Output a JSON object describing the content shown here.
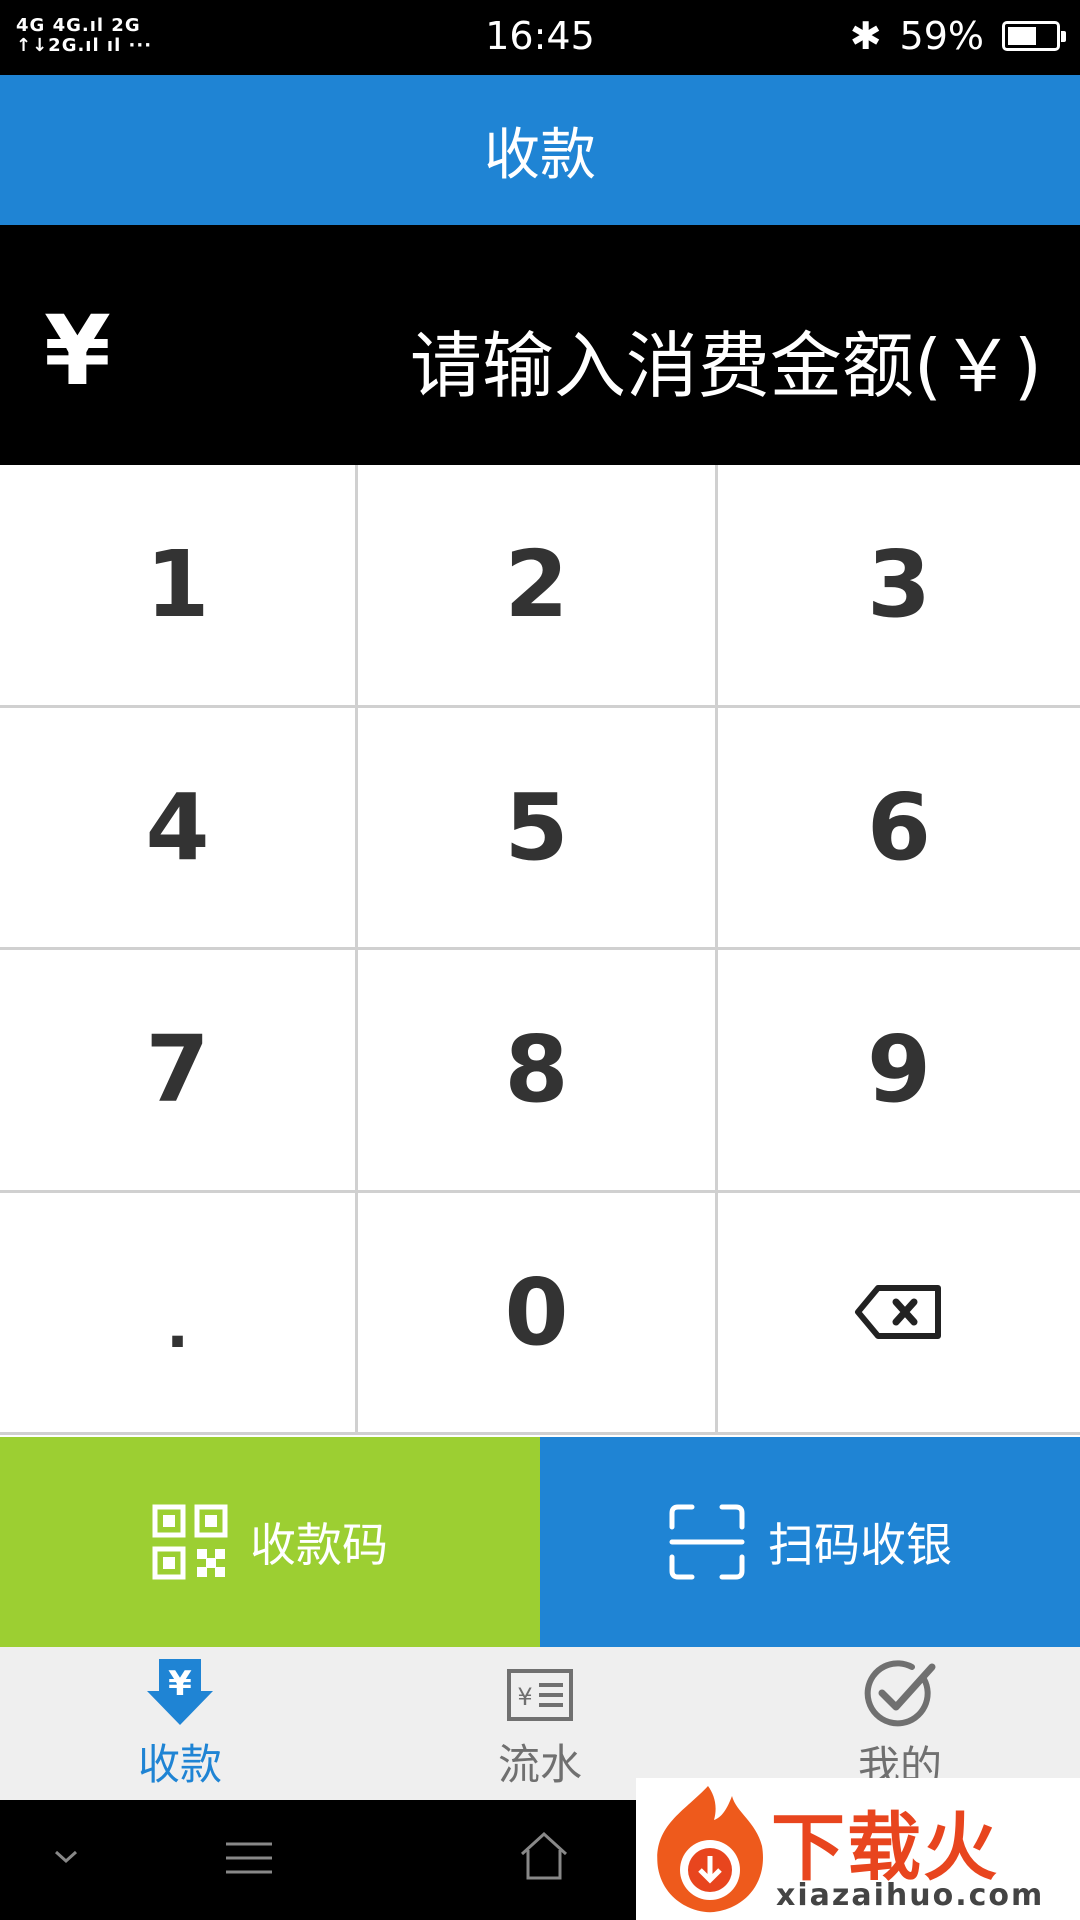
{
  "status_bar": {
    "signal_text": "4G 4G 2G",
    "time": "16:45",
    "battery": "59%",
    "icons": [
      "signal-icon",
      "bluetooth-icon",
      "battery-icon"
    ]
  },
  "header": {
    "title": "收款"
  },
  "amount": {
    "currency_symbol": "¥",
    "placeholder": "请输入消费金额(￥)"
  },
  "keypad": {
    "keys": [
      "1",
      "2",
      "3",
      "4",
      "5",
      "6",
      "7",
      "8",
      "9",
      ".",
      "0",
      "backspace-icon"
    ]
  },
  "actions": {
    "qr_label": "收款码",
    "scan_label": "扫码收银"
  },
  "tabs": [
    {
      "label": "收款",
      "icon": "download-yen-icon",
      "active": true
    },
    {
      "label": "流水",
      "icon": "receipt-icon",
      "active": false
    },
    {
      "label": "我的",
      "icon": "check-circle-icon",
      "active": false
    }
  ],
  "watermark": {
    "brand": "下载火",
    "site": "xiazaihuo.com"
  },
  "colors": {
    "primary": "#1f84d4",
    "green": "#9ccf32",
    "black": "#000000"
  }
}
